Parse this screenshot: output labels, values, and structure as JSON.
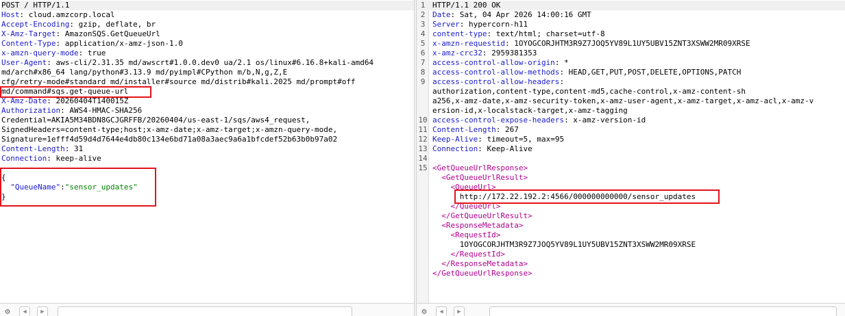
{
  "request": {
    "lines": [
      {
        "key": "",
        "val": "POST / HTTP/1.1"
      },
      {
        "key": "Host",
        "val": ": cloud.amzcorp.local"
      },
      {
        "key": "Accept-Encoding",
        "val": ": gzip, deflate, br"
      },
      {
        "key": "X-Amz-Target",
        "val": ": AmazonSQS.GetQueueUrl"
      },
      {
        "key": "Content-Type",
        "val": ": application/x-amz-json-1.0"
      },
      {
        "key": "x-amzn-query-mode",
        "val": ": true"
      },
      {
        "key": "User-Agent",
        "val": ": aws-cli/2.31.35 md/awscrt#1.0.0.dev0 ua/2.1 os/linux#6.16.8+kali-amd64"
      },
      {
        "key": "",
        "val": "md/arch#x86_64 lang/python#3.13.9 md/pyimpl#CPython m/b,N,g,Z,E"
      },
      {
        "key": "",
        "val": "cfg/retry-mode#standard md/installer#source md/distrib#kali.2025 md/prompt#off"
      },
      {
        "key": "",
        "val": "md/command#sqs.get-queue-url"
      },
      {
        "key": "X-Amz-Date",
        "val": ": 20260404T140015Z"
      },
      {
        "key": "Authorization",
        "val": ": AWS4-HMAC-SHA256"
      },
      {
        "key": "",
        "val": "Credential=AKIA5M34BDN8GCJGRFFB/20260404/us-east-1/sqs/aws4_request,"
      },
      {
        "key": "",
        "val": "SignedHeaders=content-type;host;x-amz-date;x-amz-target;x-amzn-query-mode,"
      },
      {
        "key": "",
        "val": "Signature=1efff4d59d4d7644e4db80c134e6bd71a08a3aec9a6a1bfcdef52b63b0b97a02"
      },
      {
        "key": "Content-Length",
        "val": ": 31"
      },
      {
        "key": "Connection",
        "val": ": keep-alive"
      }
    ],
    "body": {
      "open": "{",
      "key": "\"QueueName\"",
      "sep": ":",
      "value": "\"sensor_updates\"",
      "close": "}"
    }
  },
  "response": {
    "lines": [
      {
        "n": "1",
        "key": "",
        "val": "HTTP/1.1 200 OK"
      },
      {
        "n": "2",
        "key": "Date",
        "val": ": Sat, 04 Apr 2026 14:00:16 GMT"
      },
      {
        "n": "3",
        "key": "Server",
        "val": ": hypercorn-h11"
      },
      {
        "n": "4",
        "key": "content-type",
        "val": ": text/html; charset=utf-8"
      },
      {
        "n": "5",
        "key": "x-amzn-requestid",
        "val": ": 1OYOGCORJHTM3R9Z7JOQ5YV89L1UY5UBV15ZNT3XSWW2MR09XRSE"
      },
      {
        "n": "6",
        "key": "x-amz-crc32",
        "val": ": 2959381353"
      },
      {
        "n": "7",
        "key": "access-control-allow-origin",
        "val": ": *"
      },
      {
        "n": "8",
        "key": "access-control-allow-methods",
        "val": ": HEAD,GET,PUT,POST,DELETE,OPTIONS,PATCH"
      },
      {
        "n": "9",
        "key": "access-control-allow-headers",
        "val": ":"
      },
      {
        "n": "",
        "key": "",
        "val": "authorization,content-type,content-md5,cache-control,x-amz-content-sh"
      },
      {
        "n": "",
        "key": "",
        "val": "a256,x-amz-date,x-amz-security-token,x-amz-user-agent,x-amz-target,x-amz-acl,x-amz-v"
      },
      {
        "n": "",
        "key": "",
        "val": "ersion-id,x-localstack-target,x-amz-tagging"
      },
      {
        "n": "10",
        "key": "access-control-expose-headers",
        "val": ": x-amz-version-id"
      },
      {
        "n": "11",
        "key": "Content-Length",
        "val": ": 267"
      },
      {
        "n": "12",
        "key": "Keep-Alive",
        "val": ": timeout=5, max=95"
      },
      {
        "n": "13",
        "key": "Connection",
        "val": ": Keep-Alive"
      },
      {
        "n": "14",
        "key": "",
        "val": ""
      }
    ],
    "xml": [
      {
        "n": "15",
        "indent": "",
        "tag": "<GetQueueUrlResponse>",
        "text": ""
      },
      {
        "n": "",
        "indent": "  ",
        "tag": "<GetQueueUrlResult>",
        "text": ""
      },
      {
        "n": "",
        "indent": "    ",
        "tag": "<QueueUrl>",
        "text": ""
      },
      {
        "n": "",
        "indent": "      ",
        "tag": "",
        "text": "http://172.22.192.2:4566/000000000000/sensor_updates"
      },
      {
        "n": "",
        "indent": "    ",
        "tag": "</QueueUrl>",
        "text": ""
      },
      {
        "n": "",
        "indent": "  ",
        "tag": "</GetQueueUrlResult>",
        "text": ""
      },
      {
        "n": "",
        "indent": "  ",
        "tag": "<ResponseMetadata>",
        "text": ""
      },
      {
        "n": "",
        "indent": "    ",
        "tag": "<RequestId>",
        "text": ""
      },
      {
        "n": "",
        "indent": "      ",
        "tag": "",
        "text": "1OYOGCORJHTM3R9Z7JOQ5YV89L1UY5UBV15ZNT3XSWW2MR09XRSE"
      },
      {
        "n": "",
        "indent": "    ",
        "tag": "</RequestId>",
        "text": ""
      },
      {
        "n": "",
        "indent": "  ",
        "tag": "</ResponseMetadata>",
        "text": ""
      },
      {
        "n": "",
        "indent": "",
        "tag": "</GetQueueUrlResponse>",
        "text": ""
      }
    ]
  },
  "toolbar": {
    "settings_icon": "gear-icon",
    "back_icon": "arrow-left-icon",
    "forward_icon": "arrow-right-icon",
    "search_placeholder": ""
  },
  "colors": {
    "header_key": "#1a1ac8",
    "string": "#008000",
    "xml_tag": "#b0008c",
    "highlight": "#e3131b"
  }
}
